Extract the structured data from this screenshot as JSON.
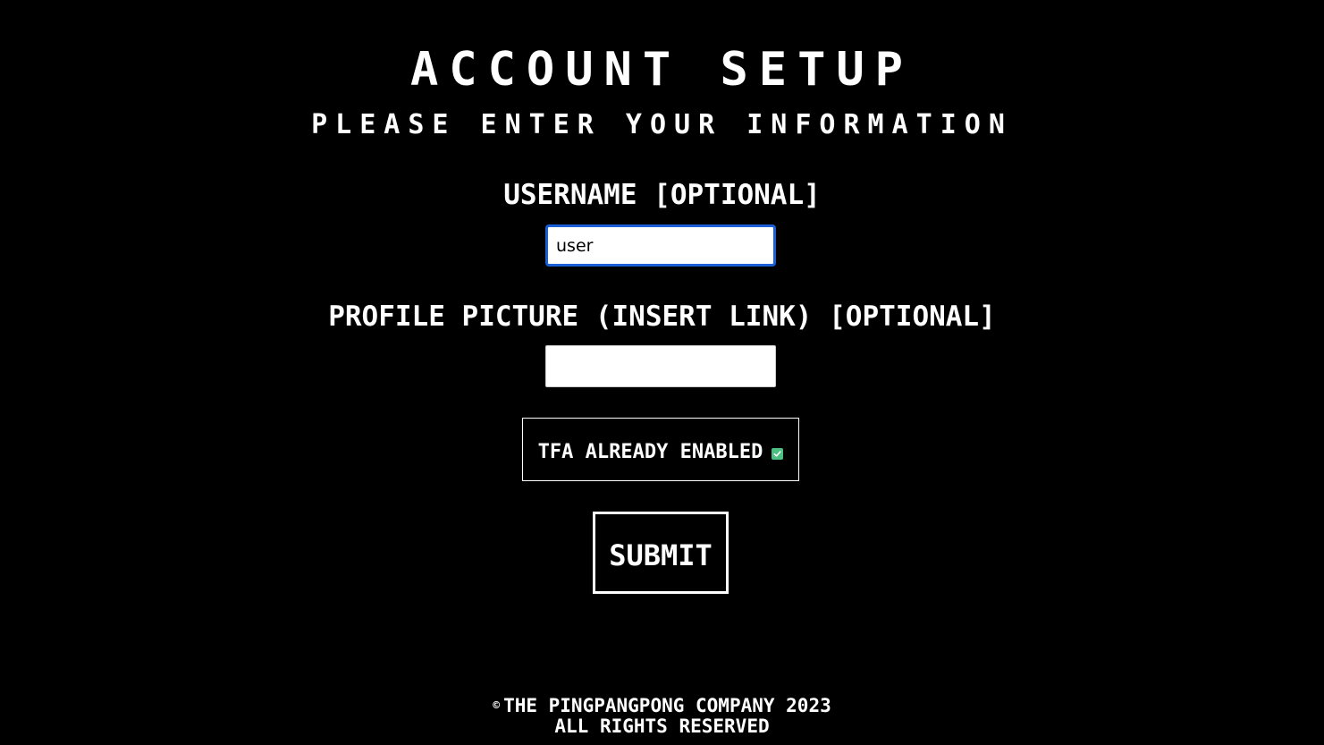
{
  "header": {
    "title": "ACCOUNT SETUP",
    "subtitle": "PLEASE ENTER YOUR INFORMATION"
  },
  "form": {
    "username": {
      "label": "USERNAME [OPTIONAL]",
      "value": "user",
      "placeholder": ""
    },
    "profile_picture": {
      "label": "PROFILE PICTURE (INSERT LINK) [OPTIONAL]",
      "value": "",
      "placeholder": ""
    },
    "tfa": {
      "label": "TFA ALREADY ENABLED",
      "checked": true,
      "check_icon": "checkmark-icon",
      "check_color": "#4cbf82"
    },
    "submit_label": "SUBMIT"
  },
  "footer": {
    "copyright_symbol": "©",
    "line1": "THE PINGPANGPONG COMPANY 2023",
    "line2": "ALL RIGHTS RESERVED"
  },
  "colors": {
    "background": "#000000",
    "text": "#ffffff",
    "focus_ring": "#1a5fd6"
  }
}
